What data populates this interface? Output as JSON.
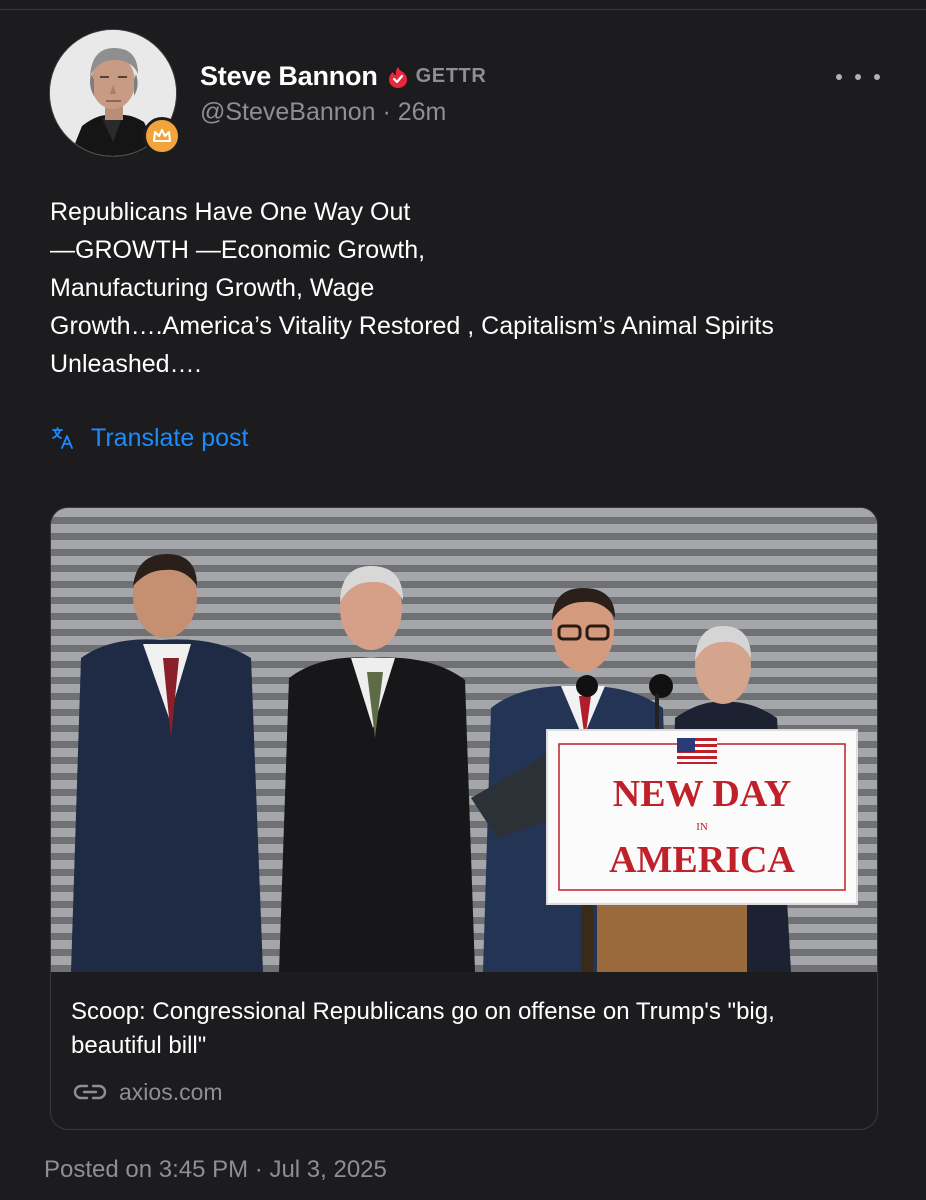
{
  "author": {
    "display_name": "Steve Bannon",
    "platform_badge": "GETTR",
    "handle": "@SteveBannon",
    "separator": "·",
    "time_ago": "26m",
    "verified_icon": "verified-flame-icon",
    "avatar_badge_icon": "crown-icon"
  },
  "post": {
    "text": "Republicans Have One Way Out\n—GROWTH —Economic Growth,\nManufacturing Growth, Wage\nGrowth….America’s Vitality Restored , Capitalism’s Animal Spirits\nUnleashed….",
    "translate_label": "Translate post",
    "translate_icon": "translate-icon"
  },
  "link_card": {
    "title": "Scoop: Congressional Republicans go on offense on Trump's \"big, beautiful bill\"",
    "domain": "axios.com",
    "domain_icon": "link-icon",
    "image": {
      "podium_sign_line1": "NEW DAY",
      "podium_sign_line2": "IN",
      "podium_sign_line3": "AMERICA"
    }
  },
  "footer": {
    "posted_on": "Posted on 3:45 PM · Jul 3, 2025"
  },
  "colors": {
    "background": "#1c1c1e",
    "accent_link": "#1a8cff",
    "muted_text": "#8e8e93",
    "verified_red": "#e8283b",
    "crown_orange": "#f0a43a",
    "sign_red": "#c0202a"
  }
}
